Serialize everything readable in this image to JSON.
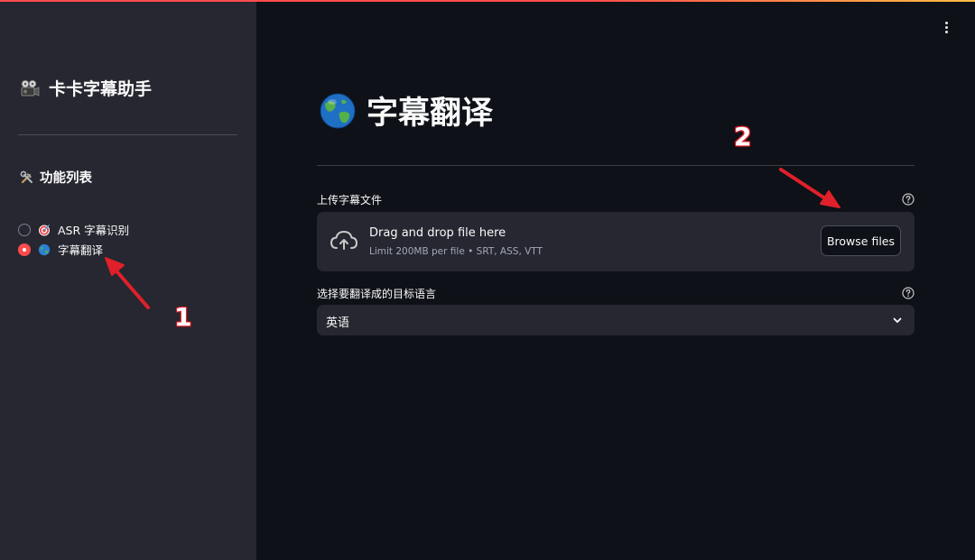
{
  "sidebar": {
    "app_title": "卡卡字幕助手",
    "app_icon": "film-projector-icon",
    "section_heading": "功能列表",
    "section_icon": "hammer-wrench-icon",
    "nav_items": [
      {
        "label": "ASR 字幕识别",
        "icon": "direct-hit-target-icon",
        "selected": false
      },
      {
        "label": "字幕翻译",
        "icon": "globe-icon",
        "selected": true
      }
    ]
  },
  "main": {
    "page_title": "字幕翻译",
    "page_icon": "globe-icon",
    "upload": {
      "label": "上传字幕文件",
      "drop_text": "Drag and drop file here",
      "limit_text": "Limit 200MB per file • SRT, ASS, VTT",
      "browse_label": "Browse files"
    },
    "language_select": {
      "label": "选择要翻译成的目标语言",
      "value": "英语"
    }
  },
  "annotations": {
    "marker_1": "1",
    "marker_2": "2",
    "color": "#e0202a"
  },
  "colors": {
    "accent": "#ff4b4b",
    "background": "#0e1117",
    "sidebar_bg": "#262730",
    "widget_bg": "#262730"
  }
}
